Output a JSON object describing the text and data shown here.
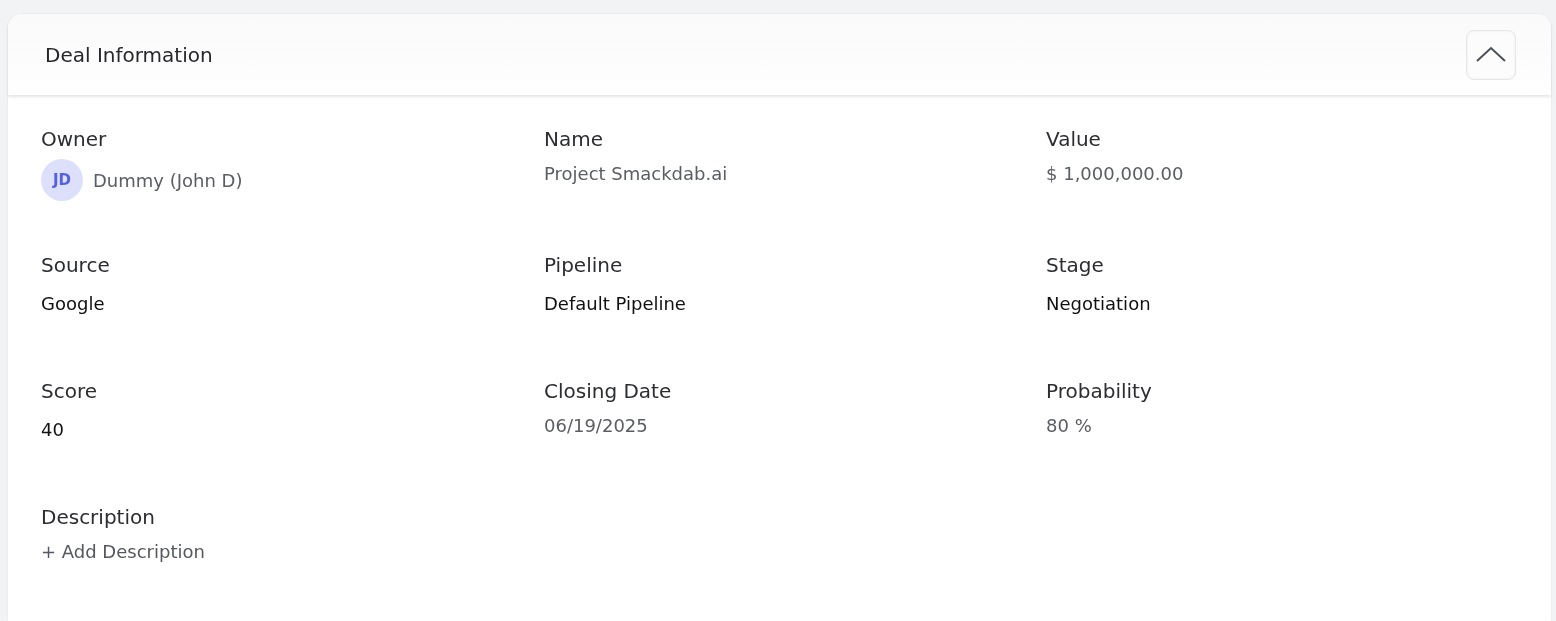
{
  "panel": {
    "title": "Deal Information",
    "expanded": true
  },
  "fields": [
    {
      "label": "Owner",
      "kind": "user",
      "initials": "JD",
      "value": "Dummy (John D)"
    },
    {
      "label": "Name",
      "kind": "plain",
      "value": "Project Smackdab.ai"
    },
    {
      "label": "Value",
      "kind": "plain",
      "value": "$ 1,000,000.00"
    },
    {
      "label": "Source",
      "kind": "choice",
      "value": "Google"
    },
    {
      "label": "Pipeline",
      "kind": "choice",
      "value": "Default Pipeline"
    },
    {
      "label": "Stage",
      "kind": "choice",
      "value": "Negotiation"
    },
    {
      "label": "Score",
      "kind": "choice",
      "value": "40"
    },
    {
      "label": "Closing Date",
      "kind": "plain",
      "value": "06/19/2025"
    },
    {
      "label": "Probability",
      "kind": "plain",
      "value": "80 %"
    },
    {
      "label": "Description",
      "kind": "action",
      "value": "+ Add Description"
    }
  ]
}
